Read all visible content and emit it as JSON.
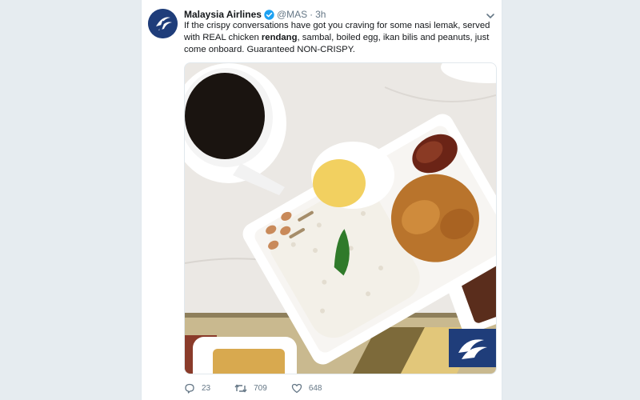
{
  "tweet": {
    "author_name": "Malaysia Airlines",
    "handle": "@MAS",
    "separator": "·",
    "time": "3h",
    "text_parts": {
      "p1": "If the crispy conversations have got you craving for some nasi lemak, served with REAL chicken ",
      "bold": "rendang",
      "p2": ", sambal, boiled egg, ikan bilis and peanuts, just come onboard. Guaranteed NON-CRISPY."
    },
    "actions": {
      "replies": "23",
      "retweets": "709",
      "likes": "648"
    }
  },
  "icons": {
    "avatar": "malaysia-airlines-logo",
    "verified": "verified-badge-icon",
    "menu": "chevron-down-icon",
    "reply": "reply-icon",
    "retweet": "retweet-icon",
    "like": "heart-icon"
  },
  "colors": {
    "page_bg": "#e6ecf0",
    "brand": "#1f3d7a",
    "verified": "#1da1f2",
    "muted": "#657786"
  }
}
